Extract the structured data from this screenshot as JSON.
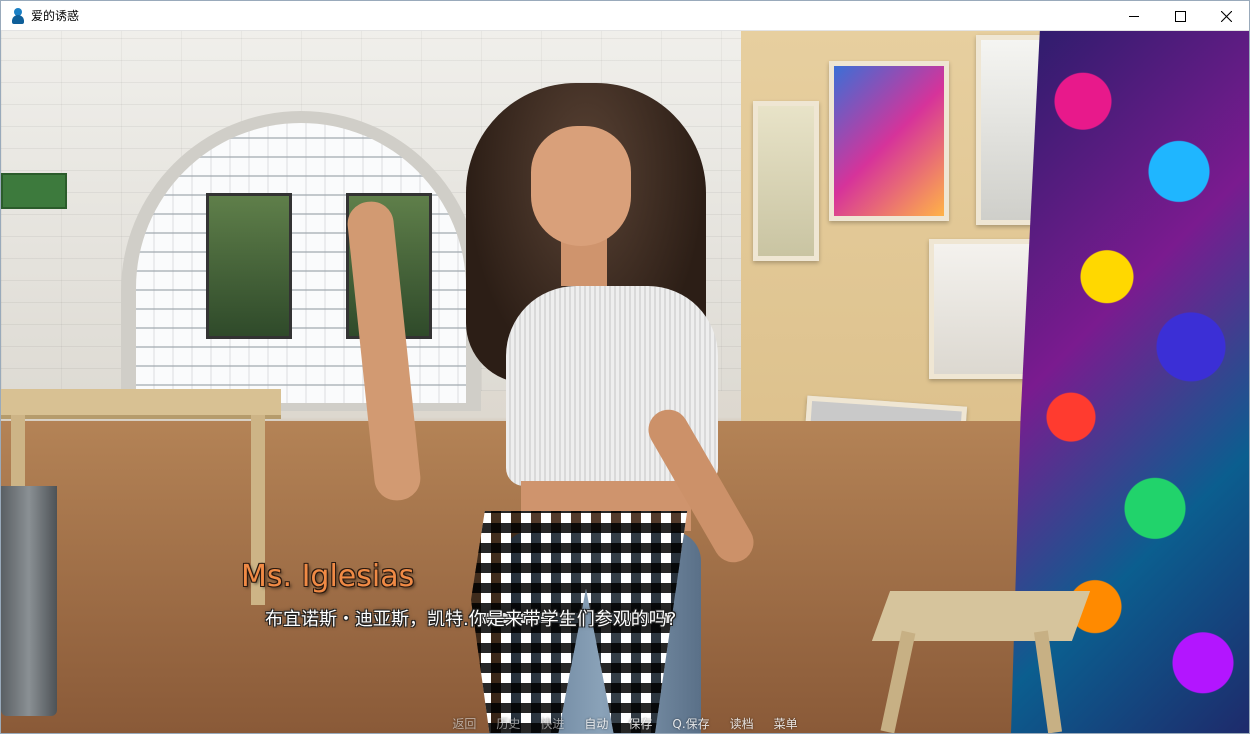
{
  "window": {
    "title": "爱的诱惑",
    "controls": [
      "minimize",
      "maximize",
      "close"
    ]
  },
  "dialogue": {
    "speaker": "Ms. Iglesias",
    "line": "布宜诺斯・迪亚斯，凯特.你是来带学生们参观的吗?",
    "speaker_color": "#f08a45"
  },
  "quick_menu": [
    {
      "label": "返回",
      "dim": true
    },
    {
      "label": "历史",
      "dim": true
    },
    {
      "label": "快进",
      "dim": true
    },
    {
      "label": "自动",
      "dim": false
    },
    {
      "label": "保存",
      "dim": false
    },
    {
      "label": "Q.保存",
      "dim": false
    },
    {
      "label": "读档",
      "dim": false
    },
    {
      "label": "菜单",
      "dim": false
    }
  ],
  "icons": {
    "app": "app-person-icon",
    "minimize": "minimize-icon",
    "maximize": "maximize-icon",
    "close": "close-icon"
  }
}
